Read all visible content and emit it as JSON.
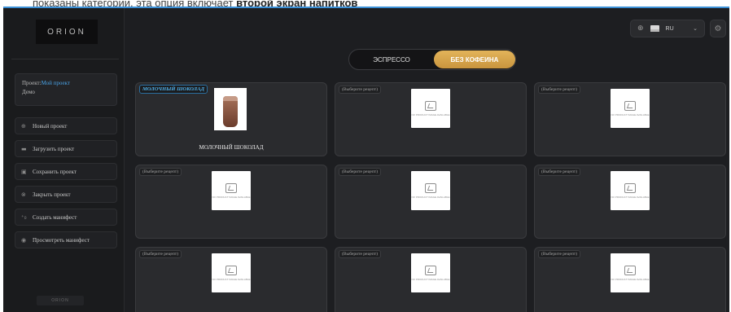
{
  "caption": {
    "prefix": "показаны категории, эта опция включает",
    "bold": "второй экран напитков"
  },
  "sidebar": {
    "logo": "ORION",
    "project": {
      "label": "Проект:",
      "name": "Мой проект",
      "sub": "Демо"
    },
    "menu": [
      {
        "icon": "plus-circle-icon",
        "glyph": "⊕",
        "label": "Новый проект"
      },
      {
        "icon": "folder-icon",
        "glyph": "▬",
        "label": "Загрузить проект"
      },
      {
        "icon": "save-icon",
        "glyph": "▣",
        "label": "Сохранить проект"
      },
      {
        "icon": "close-circle-icon",
        "glyph": "⊗",
        "label": "Закрыть проект"
      },
      {
        "icon": "create-manifest-icon",
        "glyph": "⁺₀",
        "label": "Создать манифест"
      },
      {
        "icon": "eye-icon",
        "glyph": "◉",
        "label": "Просмотреть манифест"
      }
    ],
    "bottom_logo": "ORION"
  },
  "header": {
    "lang_code": "RU",
    "globe_glyph": "⊕",
    "chevron_glyph": "⌄",
    "gear_glyph": "⚙"
  },
  "tabs": [
    {
      "label": "ЭСПРЕССО",
      "active": false
    },
    {
      "label": "БЕЗ КОФЕИНА",
      "active": true
    }
  ],
  "tiles": [
    {
      "label": "МОЛОЧНЫЙ ШОКОЛАД",
      "filled": true,
      "drink_name": "МОЛОЧНЫЙ ШОКОЛАД"
    },
    {
      "label": "(Выберите рецепт)",
      "filled": false
    },
    {
      "label": "(Выберите рецепт)",
      "filled": false
    },
    {
      "label": "(Выберите рецепт)",
      "filled": false
    },
    {
      "label": "(Выберите рецепт)",
      "filled": false
    },
    {
      "label": "(Выберите рецепт)",
      "filled": false
    },
    {
      "label": "(Выберите рецепт)",
      "filled": false
    },
    {
      "label": "(Выберите рецепт)",
      "filled": false
    },
    {
      "label": "(Выберите рецепт)",
      "filled": false
    }
  ],
  "placeholder_text": "NO PRODUCT IMAGE AVAILABLE",
  "colors": {
    "accent_gold": "#d9a54d",
    "accent_blue": "#4fb0ea",
    "background": "#1d1e21",
    "tile": "#2a2b2e"
  }
}
